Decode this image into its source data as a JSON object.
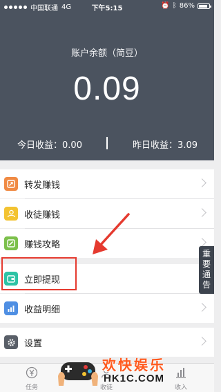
{
  "status_bar": {
    "carrier": "中国联通",
    "network": "4G",
    "time": "下午5:15",
    "battery": "86%"
  },
  "balance": {
    "label": "账户余额（简豆）",
    "amount": "0.09"
  },
  "earnings": {
    "today_label": "今日收益：",
    "today_value": "0.00",
    "yesterday_label": "昨日收益：",
    "yesterday_value": "3.09"
  },
  "menu": {
    "items": [
      {
        "label": "转发赚钱",
        "icon": "share-icon",
        "color": "#f08a43"
      },
      {
        "label": "收徒赚钱",
        "icon": "users-icon",
        "color": "#f3c331"
      },
      {
        "label": "赚钱攻略",
        "icon": "edit-icon",
        "color": "#7cc04b"
      },
      {
        "label": "立即提现",
        "icon": "wallet-icon",
        "color": "#2ec3a5"
      },
      {
        "label": "收益明细",
        "icon": "chart-icon",
        "color": "#4f8fe3"
      },
      {
        "label": "设置",
        "icon": "gear-icon",
        "color": "#595f68"
      }
    ]
  },
  "side_tab": {
    "label": "重要通告"
  },
  "tab_bar": {
    "tabs": [
      {
        "label": "任务",
        "icon": "yuan-icon"
      },
      {
        "label": "收徒",
        "icon": "users-icon"
      },
      {
        "label": "收入",
        "icon": "bar-chart-icon"
      }
    ]
  },
  "watermark": {
    "text": "欢快娱乐",
    "domain": "HK1C.COM"
  },
  "colors": {
    "header_bg": "#4b535f",
    "annotation": "#e53a2f"
  }
}
